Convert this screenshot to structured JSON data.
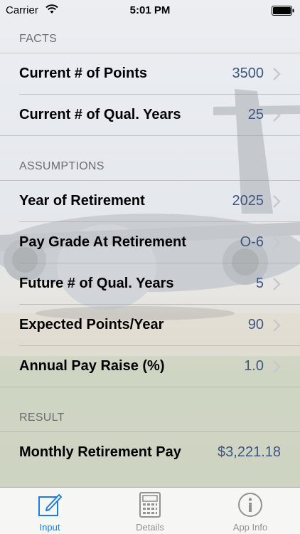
{
  "status_bar": {
    "carrier": "Carrier",
    "time": "5:01 PM"
  },
  "sections": {
    "facts": "FACTS",
    "assumptions": "ASSUMPTIONS",
    "result": "RESULT"
  },
  "facts": [
    {
      "label": "Current # of Points",
      "value": "3500"
    },
    {
      "label": "Current # of Qual. Years",
      "value": "25"
    }
  ],
  "assumptions": [
    {
      "label": "Year of Retirement",
      "value": "2025"
    },
    {
      "label": "Pay Grade At Retirement",
      "value": "O-6"
    },
    {
      "label": "Future # of Qual. Years",
      "value": "5"
    },
    {
      "label": "Expected Points/Year",
      "value": "90"
    },
    {
      "label": "Annual Pay Raise (%)",
      "value": "1.0"
    }
  ],
  "result": {
    "label": "Monthly Retirement Pay",
    "value": "$3,221.18"
  },
  "tabs": [
    {
      "label": "Input",
      "icon": "compose-icon",
      "active": true
    },
    {
      "label": "Details",
      "icon": "calculator-icon",
      "active": false
    },
    {
      "label": "App Info",
      "icon": "info-icon",
      "active": false
    }
  ],
  "colors": {
    "value_text": "#3e5680",
    "tab_active": "#1a7ee0",
    "tab_inactive": "#929292",
    "section_header": "#6d6d72"
  }
}
